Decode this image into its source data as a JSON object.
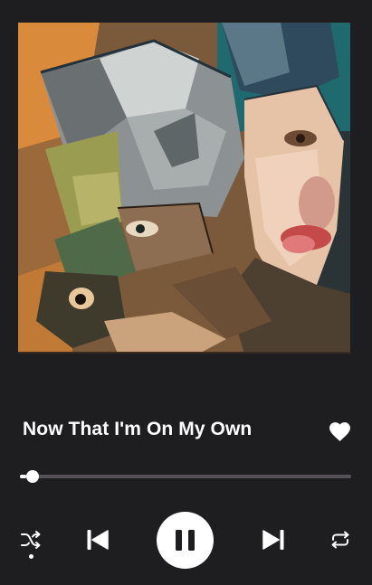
{
  "track": {
    "title": "Now That I'm On My Own",
    "liked": true
  },
  "playback": {
    "progress_fraction": 0.02,
    "is_playing": true,
    "shuffle_active": true
  },
  "icons": {
    "like": "heart-icon",
    "shuffle": "shuffle-icon",
    "previous": "skip-previous-icon",
    "play_pause": "pause-icon",
    "next": "skip-next-icon",
    "repeat": "repeat-icon"
  },
  "colors": {
    "background": "#1e1d20",
    "foreground": "#ffffff",
    "track": "#545257"
  }
}
